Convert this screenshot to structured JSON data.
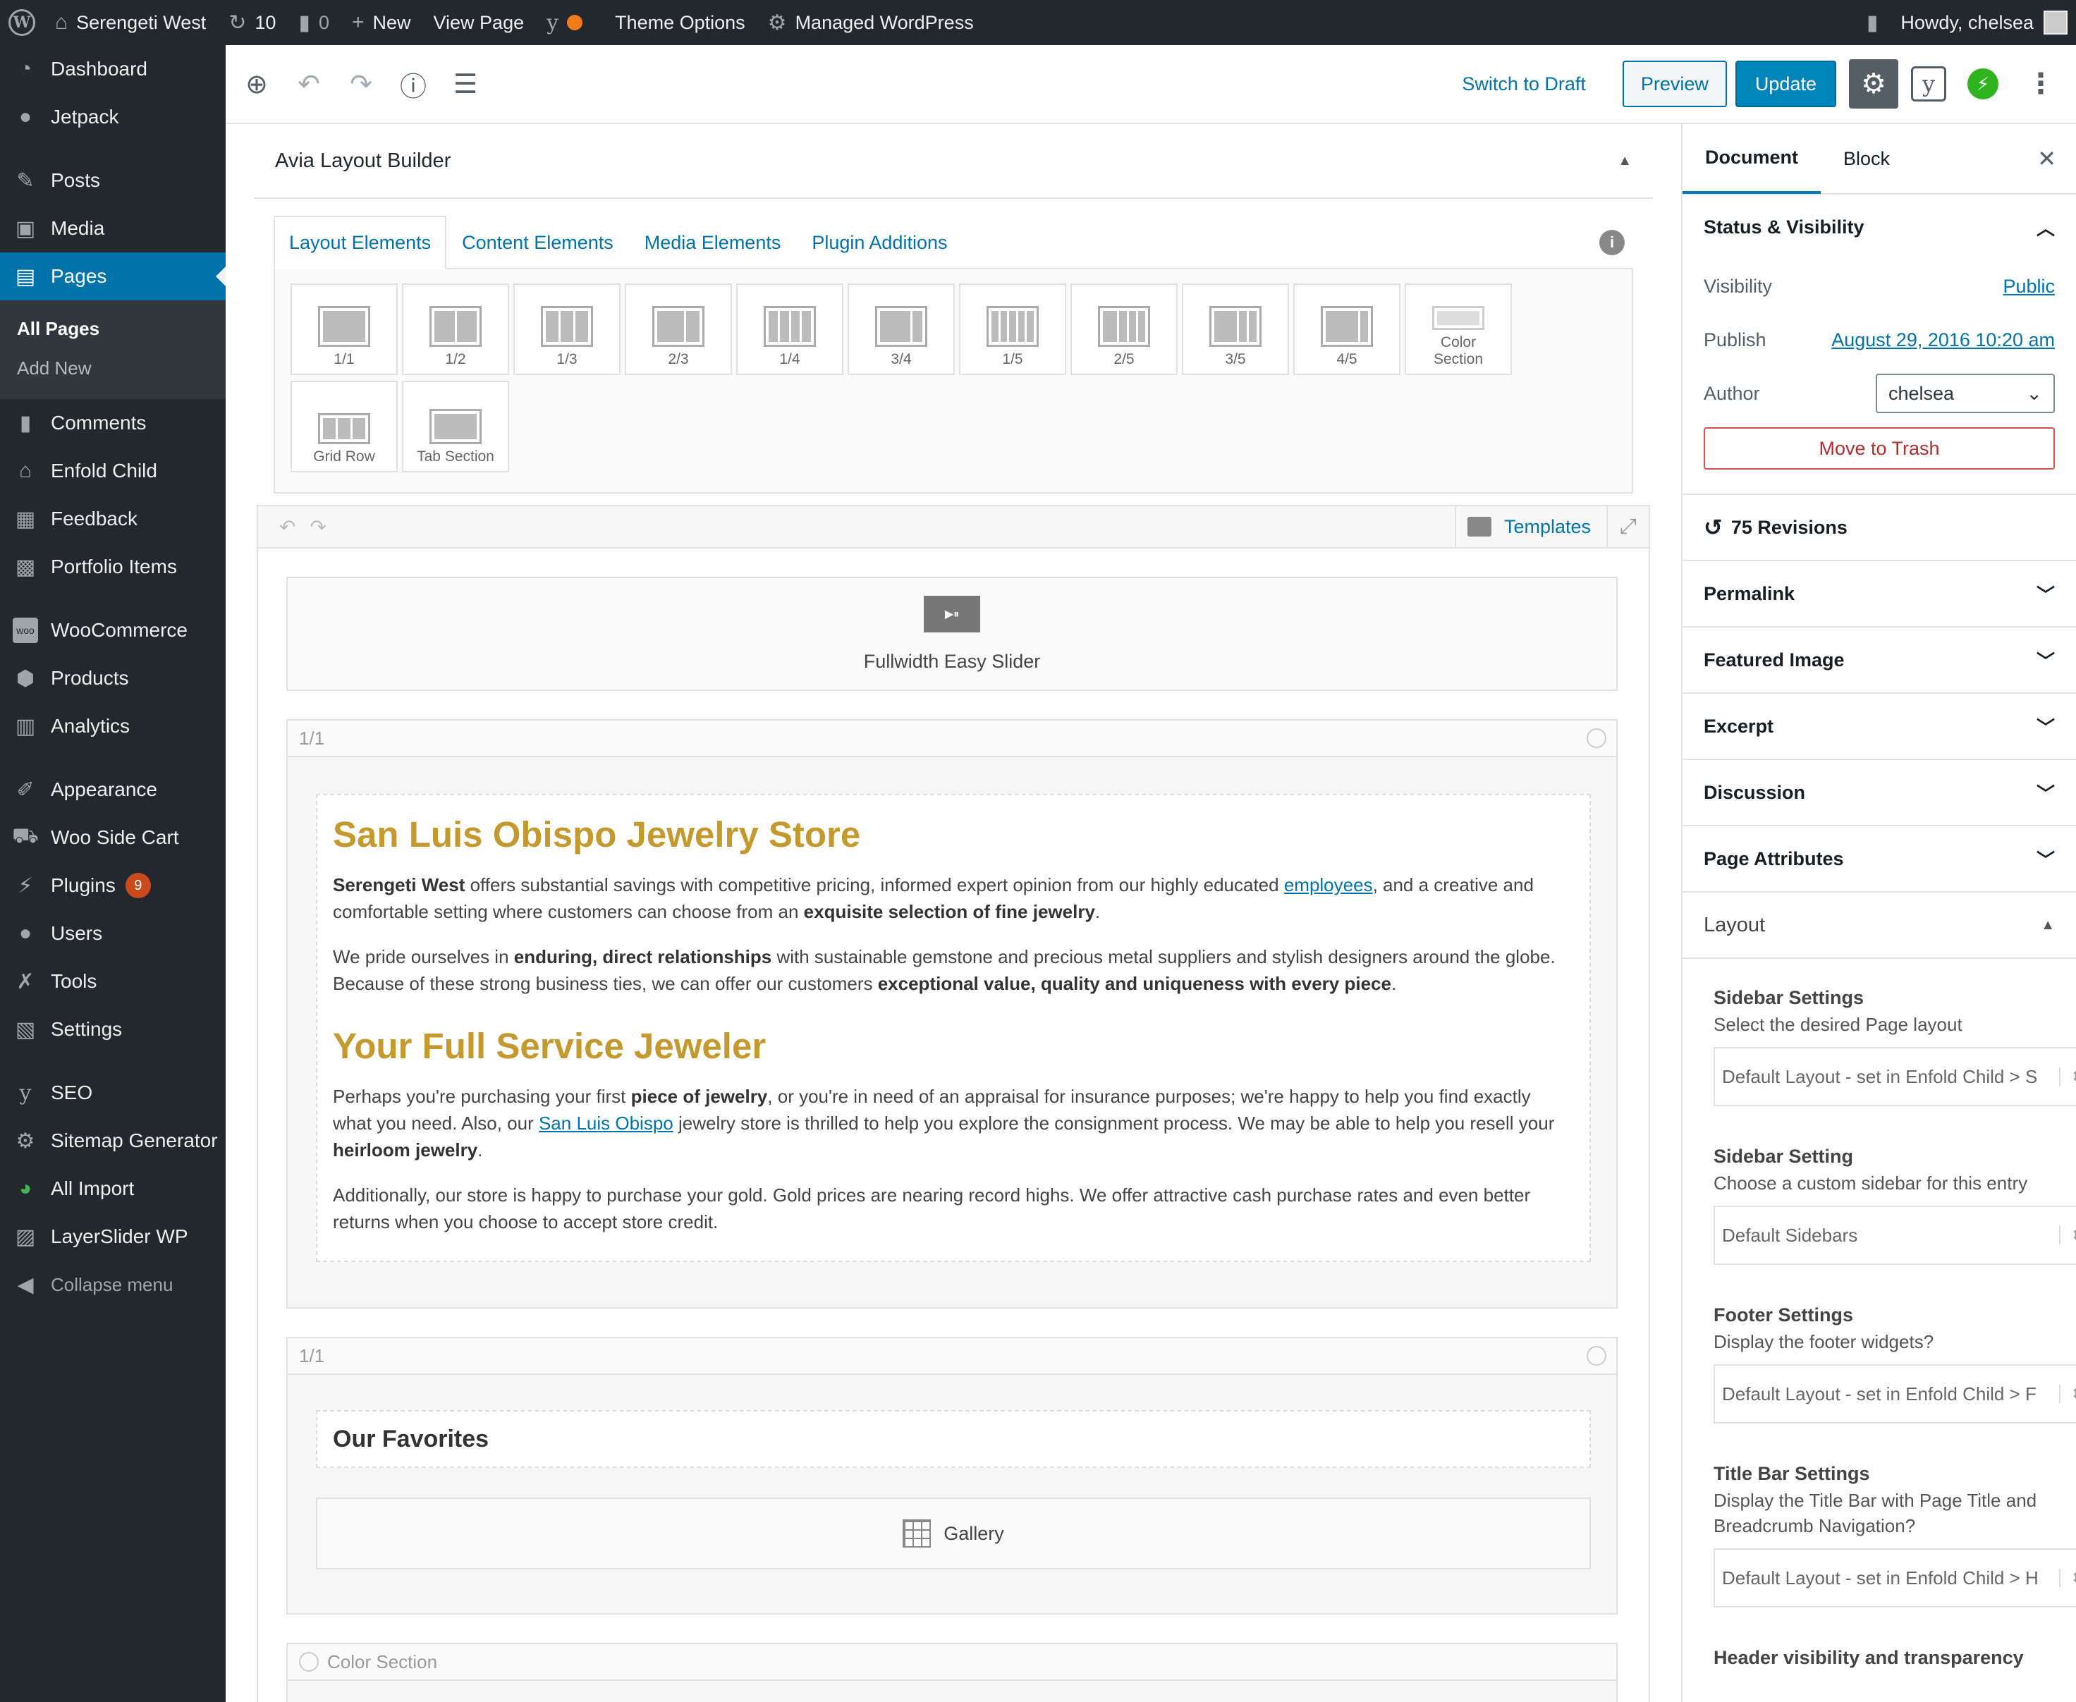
{
  "topbar": {
    "site_name": "Serengeti West",
    "updates_count": "10",
    "comments_count": "0",
    "new_label": "New",
    "view_page": "View Page",
    "theme_options": "Theme Options",
    "managed_wp": "Managed WordPress",
    "howdy": "Howdy, chelsea"
  },
  "menu": {
    "dashboard": "Dashboard",
    "jetpack": "Jetpack",
    "posts": "Posts",
    "media": "Media",
    "pages": "Pages",
    "all_pages": "All Pages",
    "add_new": "Add New",
    "comments": "Comments",
    "enfold_child": "Enfold Child",
    "feedback": "Feedback",
    "portfolio": "Portfolio Items",
    "woocommerce": "WooCommerce",
    "products": "Products",
    "analytics": "Analytics",
    "appearance": "Appearance",
    "woo_side_cart": "Woo Side Cart",
    "plugins": "Plugins",
    "plugins_badge": "9",
    "users": "Users",
    "tools": "Tools",
    "settings": "Settings",
    "seo": "SEO",
    "sitemap": "Sitemap Generator",
    "all_import": "All Import",
    "layerslider": "LayerSlider WP",
    "collapse": "Collapse menu"
  },
  "header": {
    "switch_draft": "Switch to Draft",
    "preview": "Preview",
    "update": "Update"
  },
  "avia": {
    "title": "Avia Layout Builder",
    "tabs": [
      "Layout Elements",
      "Content Elements",
      "Media Elements",
      "Plugin Additions"
    ],
    "elements": [
      "1/1",
      "1/2",
      "1/3",
      "2/3",
      "1/4",
      "3/4",
      "1/5",
      "2/5",
      "3/5",
      "4/5",
      "Color Section",
      "Grid Row",
      "Tab Section"
    ],
    "templates": "Templates",
    "slider_label": "Fullwidth Easy Slider",
    "col_label_1": "1/1",
    "col_label_2": "1/1",
    "color_section": "Color Section",
    "heading_1": "San Luis Obispo Jewelry Store",
    "p1_a": "Serengeti West",
    "p1_b": " offers substantial savings with competitive pricing, informed expert opinion from our highly educated ",
    "p1_link": "employees",
    "p1_c": ", and a creative and comfortable setting where customers can choose from an ",
    "p1_d": "exquisite selection of fine jewelry",
    "p1_e": ".",
    "p2_a": "We pride ourselves in ",
    "p2_b": "enduring, direct relationships",
    "p2_c": " with sustainable gemstone and precious metal suppliers and stylish designers around the globe. Because of these strong business ties, we can offer our customers ",
    "p2_d": "exceptional value, quality and uniqueness with every piece",
    "p2_e": ".",
    "heading_2": "Your Full Service Jeweler",
    "p3_a": "Perhaps you're purchasing your first ",
    "p3_b": "piece of jewelry",
    "p3_c": ", or you're in need of an appraisal for insurance purposes; we're happy to help you find exactly what you need. Also, our ",
    "p3_link": "San Luis Obispo",
    "p3_d": " jewelry store is thrilled to help you explore the consignment process. We may be able to help you resell your ",
    "p3_e": "heirloom jewelry",
    "p3_f": ".",
    "p4": "Additionally, our store is happy to purchase your gold. Gold prices are nearing record highs. We offer attractive cash purchase rates and even better returns when you choose to accept store credit.",
    "favorites": "Our Favorites",
    "gallery": "Gallery"
  },
  "sidebar": {
    "tab_document": "Document",
    "tab_block": "Block",
    "status_visibility": "Status & Visibility",
    "visibility_label": "Visibility",
    "visibility_value": "Public",
    "publish_label": "Publish",
    "publish_value": "August 29, 2016 10:20 am",
    "author_label": "Author",
    "author_value": "chelsea",
    "trash": "Move to Trash",
    "revisions": "75 Revisions",
    "permalink": "Permalink",
    "featured_image": "Featured Image",
    "excerpt": "Excerpt",
    "discussion": "Discussion",
    "page_attributes": "Page Attributes",
    "layout": "Layout",
    "s1_title": "Sidebar Settings",
    "s1_desc": "Select the desired Page layout",
    "s1_value": "Default Layout - set in Enfold Child > S",
    "s2_title": "Sidebar Setting",
    "s2_desc": "Choose a custom sidebar for this entry",
    "s2_value": "Default Sidebars",
    "s3_title": "Footer Settings",
    "s3_desc": "Display the footer widgets?",
    "s3_value": "Default Layout - set in Enfold Child > F",
    "s4_title": "Title Bar Settings",
    "s4_desc": "Display the Title Bar with Page Title and Breadcrumb Navigation?",
    "s4_value": "Default Layout - set in Enfold Child > H",
    "s5_title": "Header visibility and transparency"
  },
  "colors": {
    "admin_bar": "#23282d",
    "primary": "#0085ba",
    "heading_gold": "#c49a2f"
  }
}
